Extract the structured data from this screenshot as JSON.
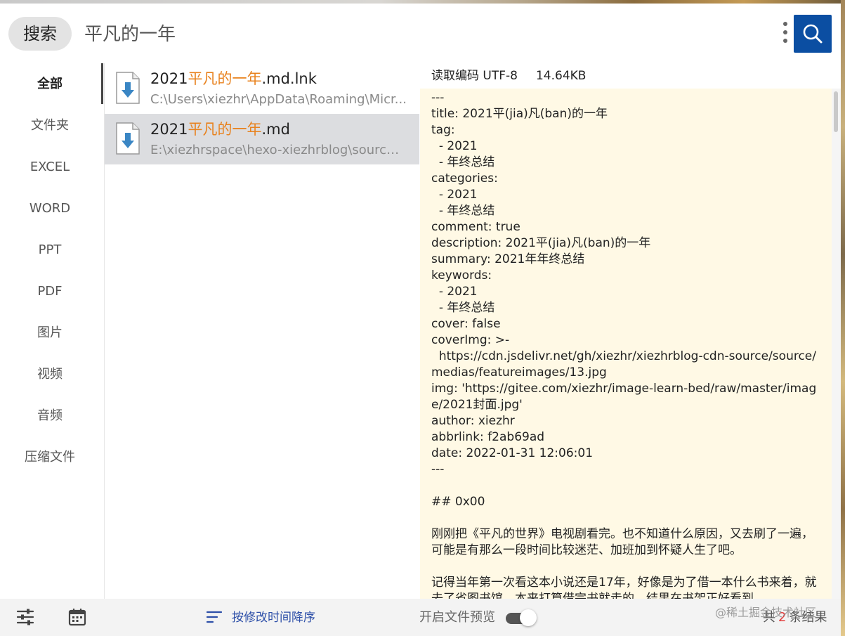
{
  "header": {
    "search_label": "搜索",
    "query": "平凡的一年"
  },
  "sidebar": {
    "items": [
      {
        "label": "全部",
        "active": true
      },
      {
        "label": "文件夹"
      },
      {
        "label": "EXCEL"
      },
      {
        "label": "WORD"
      },
      {
        "label": "PPT"
      },
      {
        "label": "PDF"
      },
      {
        "label": "图片"
      },
      {
        "label": "视频"
      },
      {
        "label": "音频"
      },
      {
        "label": "压缩文件"
      }
    ]
  },
  "results": [
    {
      "name_prefix": "2021",
      "name_highlight": "平凡的一年",
      "name_suffix": ".md.lnk",
      "path": "C:\\Users\\xiezhr\\AppData\\Roaming\\Micr...",
      "selected": false
    },
    {
      "name_prefix": "2021",
      "name_highlight": "平凡的一年",
      "name_suffix": ".md",
      "path": "E:\\xiezhrspace\\hexo-xiezhrblog\\source\\_...",
      "selected": true
    }
  ],
  "preview": {
    "encoding": "读取编码 UTF-8",
    "size": "14.64KB",
    "content": "---\ntitle: 2021平(jia)凡(ban)的一年\ntag:\n  - 2021\n  - 年终总结\ncategories:\n  - 2021\n  - 年终总结\ncomment: true\ndescription: 2021平(jia)凡(ban)的一年\nsummary: 2021年年终总结\nkeywords:\n  - 2021\n  - 年终总结\ncover: false\ncoverImg: >-\n  https://cdn.jsdelivr.net/gh/xiezhr/xiezhrblog-cdn-source/source/medias/featureimages/13.jpg\nimg: 'https://gitee.com/xiezhr/image-learn-bed/raw/master/image/2021封面.jpg'\nauthor: xiezhr\nabbrlink: f2ab69ad\ndate: 2022-01-31 12:06:01\n---\n\n## 0x00\n\n刚刚把《平凡的世界》电视剧看完。也不知道什么原因，又去刷了一遍， 可能是有那么一段时间比较迷茫、加班加到怀疑人生了吧。\n\n记得当年第一次看这本小说还是17年，好像是为了借一本什么书来着，就去了省图书馆。本来打算借完书就走的，结果在书架正好看到"
  },
  "footer": {
    "sort_label": "按修改时间降序",
    "preview_toggle_label": "开启文件预览",
    "preview_toggle_on": true,
    "result_prefix": "共",
    "result_count": "2",
    "result_suffix": "条结果",
    "watermark": "@稀土掘金技术社区"
  },
  "colors": {
    "accent": "#0b4ea2",
    "highlight": "#e8821e",
    "preview_bg": "#fff9e5",
    "selected_row": "#dcdde0"
  },
  "icons": [
    "more-vert-icon",
    "search-icon",
    "file-shortcut-icon",
    "file-download-icon",
    "filter-settings-icon",
    "calendar-icon",
    "sort-icon"
  ]
}
